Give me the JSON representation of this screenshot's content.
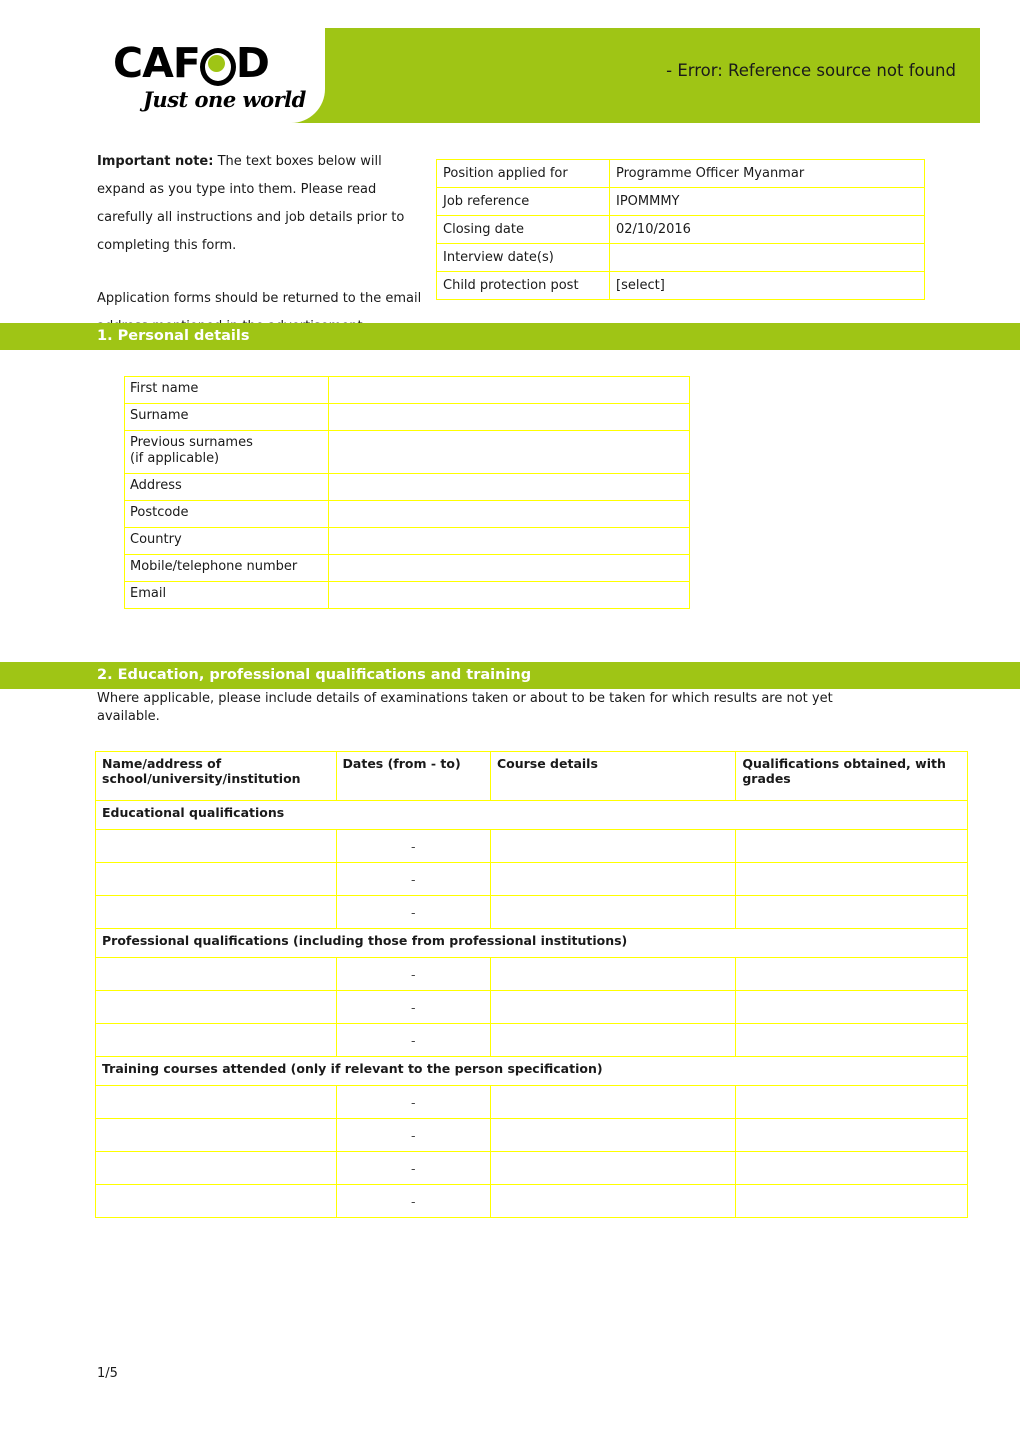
{
  "header": {
    "logo_word_part1": "CAF",
    "logo_word_part2": "D",
    "logo_tagline": "Just one world",
    "title": "- Error: Reference source not found",
    "brand_green": "#9fc515",
    "logo_dot_color": "#9fc515"
  },
  "intro": {
    "note_label": "Important note:",
    "note_body": " The text boxes below will expand as you type into them. Please read carefully all instructions and job details prior to completing this form.",
    "return_text": "Application forms should be returned to the email address mentioned in the advertisement"
  },
  "info_table": {
    "rows": [
      {
        "label": "Position applied for",
        "value": "Programme Officer Myanmar"
      },
      {
        "label": "Job reference",
        "value": "IPOMMMY"
      },
      {
        "label": "Closing date",
        "value": "02/10/2016"
      },
      {
        "label": "Interview date(s)",
        "value": ""
      },
      {
        "label": "Child protection post",
        "value": "[select]"
      }
    ]
  },
  "section1": {
    "title": "1. Personal details",
    "fields": [
      {
        "label": "First name",
        "value": ""
      },
      {
        "label": "Surname",
        "value": ""
      },
      {
        "label": "Previous surnames\n(if applicable)",
        "value": ""
      },
      {
        "label": "Address",
        "value": ""
      },
      {
        "label": "Postcode",
        "value": ""
      },
      {
        "label": "Country",
        "value": ""
      },
      {
        "label": "Mobile/telephone number",
        "value": ""
      },
      {
        "label": "Email",
        "value": ""
      }
    ]
  },
  "section2": {
    "title": "2. Education, professional qualifications and training",
    "description": "Where applicable, please include details of examinations taken or about to be taken for which results are not yet available.",
    "columns": [
      "Name/address of school/university/institution",
      "Dates (from - to)",
      "Course details",
      "Qualifications obtained, with grades"
    ],
    "groups": [
      {
        "heading": "Educational qualifications",
        "rows": [
          {
            "institution": "",
            "dates": "-",
            "course": "",
            "qualifications": ""
          },
          {
            "institution": "",
            "dates": "-",
            "course": "",
            "qualifications": ""
          },
          {
            "institution": "",
            "dates": "-",
            "course": "",
            "qualifications": ""
          }
        ]
      },
      {
        "heading": "Professional qualifications (including those from professional institutions)",
        "rows": [
          {
            "institution": "",
            "dates": "-",
            "course": "",
            "qualifications": ""
          },
          {
            "institution": "",
            "dates": "-",
            "course": "",
            "qualifications": ""
          },
          {
            "institution": "",
            "dates": "-",
            "course": "",
            "qualifications": ""
          }
        ]
      },
      {
        "heading": "Training courses attended (only if relevant to the person specification)",
        "rows": [
          {
            "institution": "",
            "dates": "-",
            "course": "",
            "qualifications": ""
          },
          {
            "institution": "",
            "dates": "-",
            "course": "",
            "qualifications": ""
          },
          {
            "institution": "",
            "dates": "-",
            "course": "",
            "qualifications": ""
          },
          {
            "institution": "",
            "dates": "-",
            "course": "",
            "qualifications": ""
          }
        ]
      }
    ]
  },
  "footer": {
    "page_number": "1/5"
  }
}
